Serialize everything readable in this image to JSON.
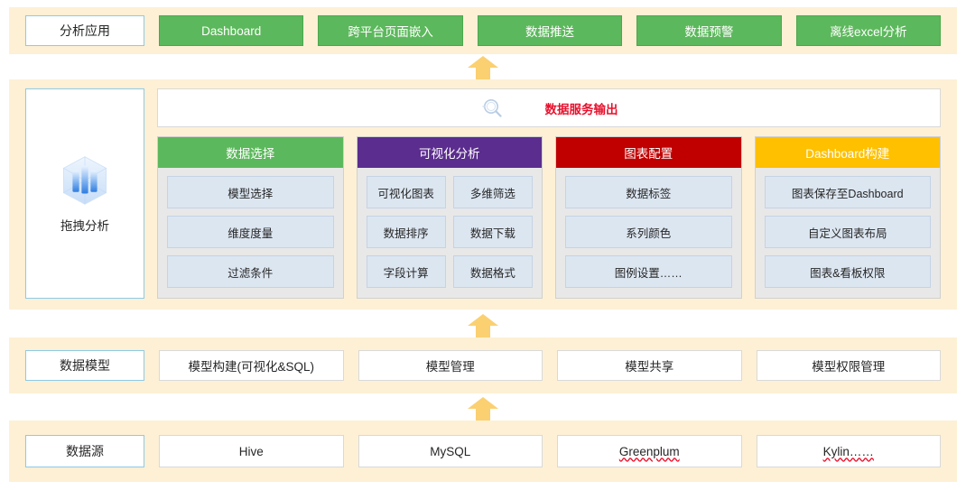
{
  "colors": {
    "panel_bg": "#fdf0d5",
    "green": "#5cb85c",
    "purple": "#5b2d8e",
    "red": "#c00000",
    "gold": "#ffc000",
    "arrow": "#fbd071",
    "chip_bg": "#dce6f1",
    "label_border": "#8ecae6",
    "output_text": "#e8112d"
  },
  "bands": {
    "apps": {
      "label": "分析应用",
      "items": [
        "Dashboard",
        "跨平台页面嵌入",
        "数据推送",
        "数据预警",
        "离线excel分析"
      ]
    },
    "analysis": {
      "label": "拖拽分析",
      "icon": "data-cube-icon",
      "output_bar": {
        "icon": "search-icon",
        "text": "数据服务输出"
      },
      "stages": [
        {
          "title": "数据选择",
          "color": "#5cb85c",
          "columns": 1,
          "chips": [
            "模型选择",
            "维度度量",
            "过滤条件"
          ]
        },
        {
          "title": "可视化分析",
          "color": "#5b2d8e",
          "columns": 2,
          "chips": [
            "可视化图表",
            "多维筛选",
            "数据排序",
            "数据下载",
            "字段计算",
            "数据格式"
          ]
        },
        {
          "title": "图表配置",
          "color": "#c00000",
          "columns": 1,
          "chips": [
            "数据标签",
            "系列颜色",
            "图例设置……"
          ]
        },
        {
          "title": "Dashboard构建",
          "color": "#ffc000",
          "columns": 1,
          "chips": [
            "图表保存至Dashboard",
            "自定义图表布局",
            "图表&看板权限"
          ]
        }
      ]
    },
    "model": {
      "label": "数据模型",
      "items": [
        "模型构建(可视化&SQL)",
        "模型管理",
        "模型共享",
        "模型权限管理"
      ]
    },
    "source": {
      "label": "数据源",
      "items": [
        {
          "text": "Hive",
          "spellcheck_error": false
        },
        {
          "text": "MySQL",
          "spellcheck_error": false
        },
        {
          "text": "Greenplum",
          "spellcheck_error": true
        },
        {
          "text": "Kylin……",
          "spellcheck_error": true
        }
      ]
    }
  },
  "arrows": [
    {
      "name": "arrow-apps",
      "direction": "up"
    },
    {
      "name": "arrow-analysis",
      "direction": "up"
    },
    {
      "name": "arrow-model",
      "direction": "up"
    }
  ]
}
